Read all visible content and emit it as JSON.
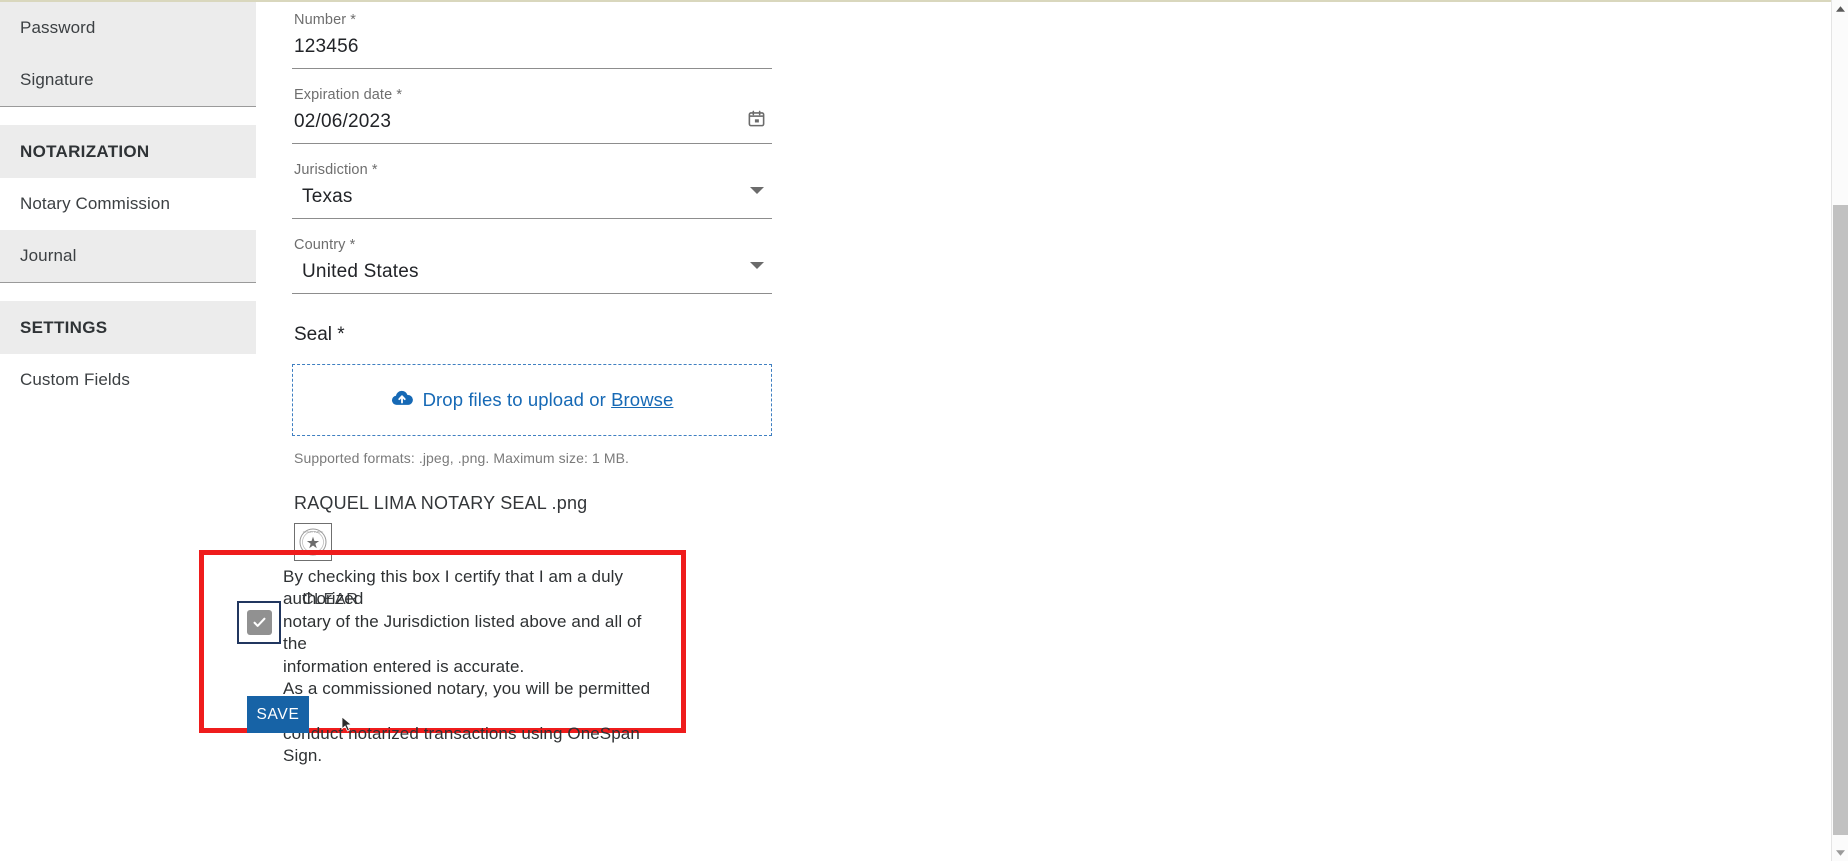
{
  "sidebar": {
    "items": [
      {
        "label": "Password",
        "style": "shaded"
      },
      {
        "label": "Signature",
        "style": "shaded"
      }
    ],
    "sections": [
      {
        "header": "NOTARIZATION",
        "items": [
          {
            "label": "Notary Commission",
            "style": "plain"
          },
          {
            "label": "Journal",
            "style": "shaded"
          }
        ]
      },
      {
        "header": "SETTINGS",
        "items": [
          {
            "label": "Custom Fields",
            "style": "plain"
          }
        ]
      }
    ]
  },
  "form": {
    "fields": [
      {
        "label": "Number *",
        "value": "123456",
        "icon": "none"
      },
      {
        "label": "Expiration date *",
        "value": "02/06/2023",
        "icon": "calendar-icon"
      },
      {
        "label": "Jurisdiction *",
        "value": "Texas",
        "icon": "chevron-down-icon"
      },
      {
        "label": "Country *",
        "value": "United States",
        "icon": "chevron-down-icon"
      }
    ],
    "seal": {
      "label": "Seal *",
      "dropzone_text": "Drop files to upload or ",
      "dropzone_browse": "Browse",
      "dropzone_icon": "cloud-upload-icon",
      "hint": "Supported formats: .jpeg, .png. Maximum size: 1 MB.",
      "filename": "RAQUEL LIMA NOTARY SEAL .png",
      "thumbnail_icon": "notary-seal-thumbnail",
      "clear_label": "CLEAR"
    },
    "consent": {
      "line1": "By checking this box I certify that I am a duly authorized",
      "line2": "notary of the Jurisdiction listed above and all of the",
      "line3": "information entered is accurate.",
      "line4": "As a commissioned notary, you will be permitted to",
      "line5": "conduct notarized transactions using OneSpan Sign.",
      "checked": true
    },
    "save_label": "SAVE"
  },
  "colors": {
    "accent_blue": "#1763a6",
    "link_blue": "#1669b5",
    "highlight_red": "#ef1c1c",
    "sidebar_shade": "#ececec",
    "checkbox_fill": "#919191",
    "checkbox_focus_outline": "#21365f"
  },
  "scrollbar": {
    "up_arrow_icon": "scroll-up-arrow-icon",
    "down_arrow_icon": "scroll-down-arrow-icon"
  }
}
